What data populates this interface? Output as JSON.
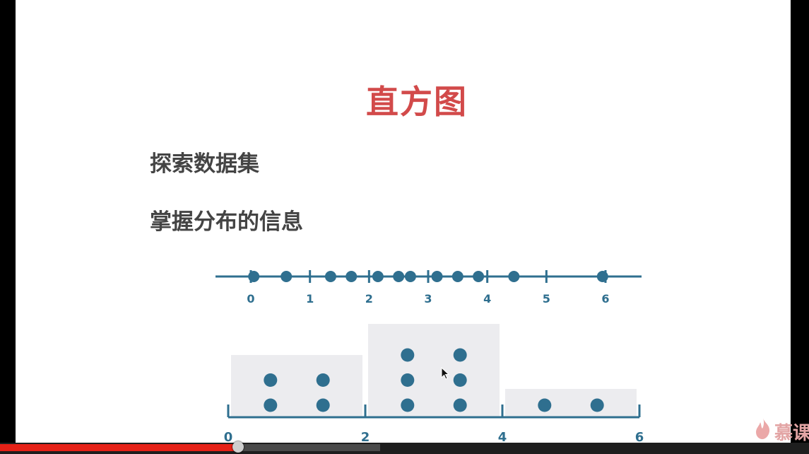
{
  "slide": {
    "title": "直方图",
    "bullets": [
      "探索数据集",
      "掌握分布的信息"
    ]
  },
  "colors": {
    "title": "#d24a4a",
    "dot": "#2f6f8f",
    "axis": "#2f6f8f",
    "bar_fill": "#ececef",
    "progress_played": "#e62117"
  },
  "chart_data": {
    "type": "scatter",
    "number_line": {
      "ticks": [
        "0",
        "1",
        "2",
        "3",
        "4",
        "5",
        "6"
      ],
      "points": [
        0.05,
        0.6,
        1.35,
        1.7,
        2.15,
        2.5,
        2.7,
        3.15,
        3.5,
        3.85,
        4.45,
        5.95
      ]
    },
    "histogram": {
      "type": "bar",
      "tick_labels": [
        "0",
        "2",
        "4",
        "6"
      ],
      "bins": [
        {
          "from": 0,
          "to": 2,
          "count": 4
        },
        {
          "from": 2,
          "to": 4,
          "count": 6
        },
        {
          "from": 4,
          "to": 6,
          "count": 2
        }
      ]
    }
  },
  "player": {
    "progress_fraction": 0.294,
    "buffered_fraction": 0.47
  },
  "watermark": {
    "text": "慕课"
  }
}
